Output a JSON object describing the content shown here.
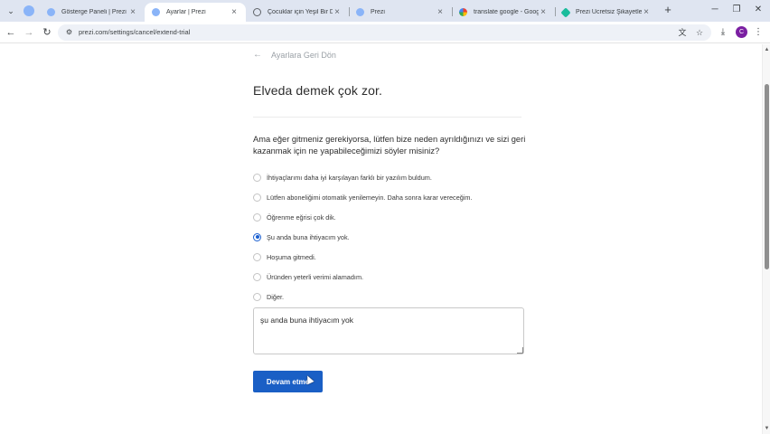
{
  "browser": {
    "tabs": [
      {
        "title": "Gösterge Paneli | Prezi",
        "favicon": "prezi-icon",
        "active": false
      },
      {
        "title": "Ayarlar | Prezi",
        "favicon": "prezi-icon",
        "active": true
      },
      {
        "title": "Çocuklar için Yeşil Bir Dü",
        "favicon": "globe-icon",
        "active": false
      },
      {
        "title": "Prezi",
        "favicon": "prezi-icon",
        "active": false
      },
      {
        "title": "translate google - Google",
        "favicon": "google-icon",
        "active": false
      },
      {
        "title": "Prezi Ücretsiz Şikayetleri",
        "favicon": "sikayetvar-icon",
        "active": false
      }
    ],
    "url": "prezi.com/settings/cancel/extend-trial",
    "profile_initial": "C",
    "accent": "#7b1fa2"
  },
  "page": {
    "back_label": "Ayarlara Geri Dön",
    "title": "Elveda demek çok zor.",
    "question": "Ama eğer gitmeniz gerekiyorsa, lütfen bize neden ayrıldığınızı ve sizi geri kazanmak için ne yapabileceğimizi söyler misiniz?",
    "options": [
      {
        "label": "İhtiyaçlarımı daha iyi karşılayan farklı bir yazılım buldum.",
        "checked": false
      },
      {
        "label": "Lütfen aboneliğimi otomatik yenilemeyin. Daha sonra karar vereceğim.",
        "checked": false
      },
      {
        "label": "Öğrenme eğrisi çok dik.",
        "checked": false
      },
      {
        "label": "Şu anda buna ihtiyacım yok.",
        "checked": true
      },
      {
        "label": "Hoşuma gitmedi.",
        "checked": false
      },
      {
        "label": "Üründen yeterli verimi alamadım.",
        "checked": false
      },
      {
        "label": "Diğer.",
        "checked": false
      }
    ],
    "feedback_value": "şu anda buna ihtiyacım yok",
    "submit_label": "Devam etme",
    "primary_color": "#1a5fc5"
  }
}
